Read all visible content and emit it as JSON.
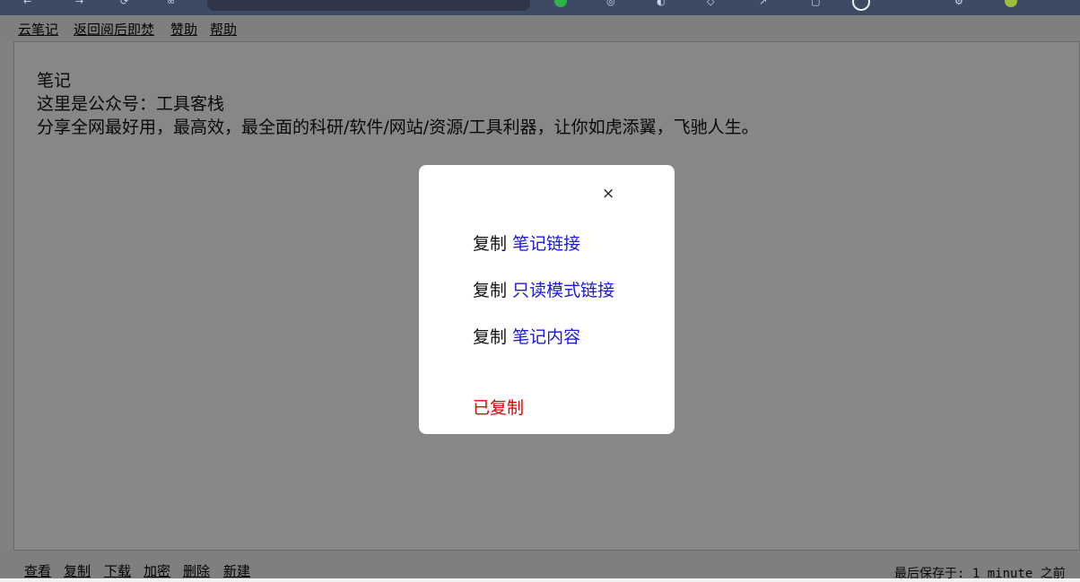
{
  "top_nav": {
    "items": [
      "云笔记",
      "返回阅后即焚",
      "赞助",
      "帮助"
    ]
  },
  "editor": {
    "lines": [
      "笔记",
      "这里是公众号：工具客栈",
      "分享全网最好用，最高效，最全面的科研/软件/网站/资源/工具利器，让你如虎添翼，飞驰人生。"
    ]
  },
  "bottom_nav": {
    "items": [
      "查看",
      "复制",
      "下载",
      "加密",
      "删除",
      "新建"
    ],
    "saved_text": "最后保存于: 1 minute 之前"
  },
  "modal": {
    "close_glyph": "×",
    "options": [
      {
        "verb": "复制",
        "target": "笔记链接"
      },
      {
        "verb": "复制",
        "target": "只读模式链接"
      },
      {
        "verb": "复制",
        "target": "笔记内容"
      }
    ],
    "status": "已复制",
    "colors": {
      "link": "#1a1adb",
      "status": "#e00000"
    }
  }
}
